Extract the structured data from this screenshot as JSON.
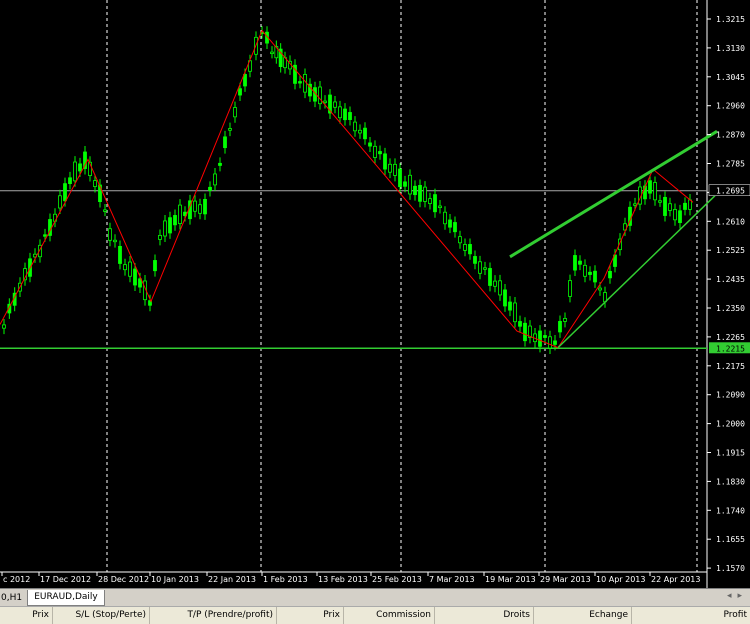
{
  "chart": {
    "symbol_tab_left": "0,H1",
    "symbol_tab_active": "EURAUD,Daily",
    "price_axis": [
      "1.3215",
      "1.3130",
      "1.3045",
      "1.2960",
      "1.2870",
      "1.2785",
      "1.2695",
      "1.2610",
      "1.2525",
      "1.2435",
      "1.2350",
      "1.2265",
      "1.2175",
      "1.2090",
      "1.2000",
      "1.1915",
      "1.1830",
      "1.1740",
      "1.1655",
      "1.1570"
    ],
    "current_price": "1.2695",
    "support_price": "1.2215",
    "date_axis": [
      "c 2012",
      "17 Dec 2012",
      "28 Dec 2012",
      "10 Jan 2013",
      "22 Jan 2013",
      "1 Feb 2013",
      "13 Feb 2013",
      "25 Feb 2013",
      "7 Mar 2013",
      "19 Mar 2013",
      "29 Mar 2013",
      "10 Apr 2013",
      "22 Apr 2013"
    ]
  },
  "terminal": {
    "columns": [
      "Prix",
      "S/L (Stop/Perte)",
      "T/P (Prendre/profit)",
      "Prix",
      "Commission",
      "Droits",
      "Echange",
      "Profit"
    ]
  },
  "colors": {
    "candle": "#00ff00",
    "zigzag": "#ff0000",
    "trendline": "#32cd32",
    "grid": "#ffffff",
    "background": "#000000"
  }
}
